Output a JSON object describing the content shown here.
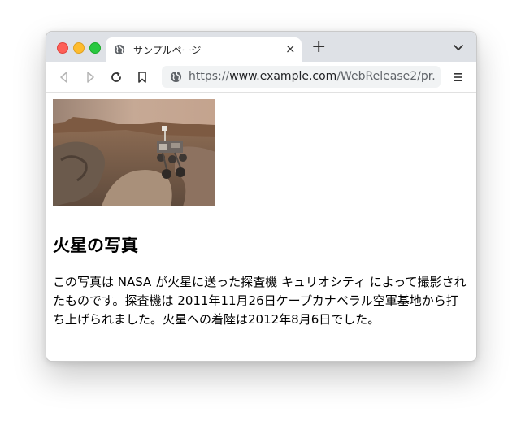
{
  "browser": {
    "tab_title": "サンプルページ",
    "tab_close_glyph": "×",
    "new_tab_glyph": "+",
    "url_scheme": "https://",
    "url_domain": "www.example.com",
    "url_path": "/WebRelease2/pr..."
  },
  "page": {
    "heading": "火星の写真",
    "paragraph": "この写真は NASA が火星に送った探査機 キュリオシティ によって撮影されたものです。探査機は 2011年11月26日ケープカナベラル空軍基地から打ち上げられました。火星への着陸は2012年8月6日でした。"
  },
  "icons": {
    "tab_favicon": "globe-icon",
    "back": "back-arrow-icon",
    "forward": "forward-arrow-icon",
    "reload": "reload-icon",
    "bookmark": "bookmark-icon",
    "site_info": "globe-icon",
    "menu": "menu-icon",
    "tab_list": "chevron-down-icon"
  },
  "colors": {
    "tab_bar": "#dee1e6",
    "address_bar": "#f1f3f4",
    "close_red": "#fe5f57",
    "minimize_yellow": "#febc2e",
    "zoom_green": "#28c840"
  }
}
